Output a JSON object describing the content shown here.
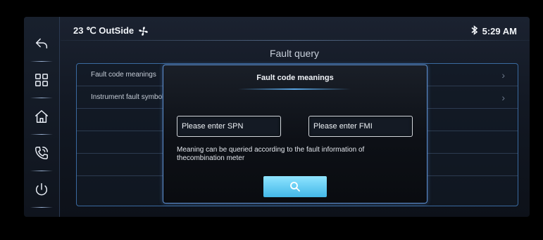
{
  "status": {
    "temperature": "23 ℃ OutSide",
    "time": "5:29 AM"
  },
  "rail": {
    "icons": [
      "back-icon",
      "apps-grid-icon",
      "home-icon",
      "phone-icon",
      "power-icon"
    ]
  },
  "page": {
    "title": "Fault query"
  },
  "list": {
    "items": [
      {
        "label": "Fault code meanings"
      },
      {
        "label": "Instrument fault symbols"
      },
      {
        "label": ""
      },
      {
        "label": ""
      },
      {
        "label": ""
      },
      {
        "label": ""
      }
    ]
  },
  "modal": {
    "title": "Fault code meanings",
    "spn_placeholder": "Please enter SPN",
    "fmi_placeholder": "Please enter FMI",
    "hint": "Meaning can be queried according to the fault information of thecombination meter"
  },
  "colors": {
    "accent": "#5d8fd0",
    "button": "#43b8e8"
  }
}
